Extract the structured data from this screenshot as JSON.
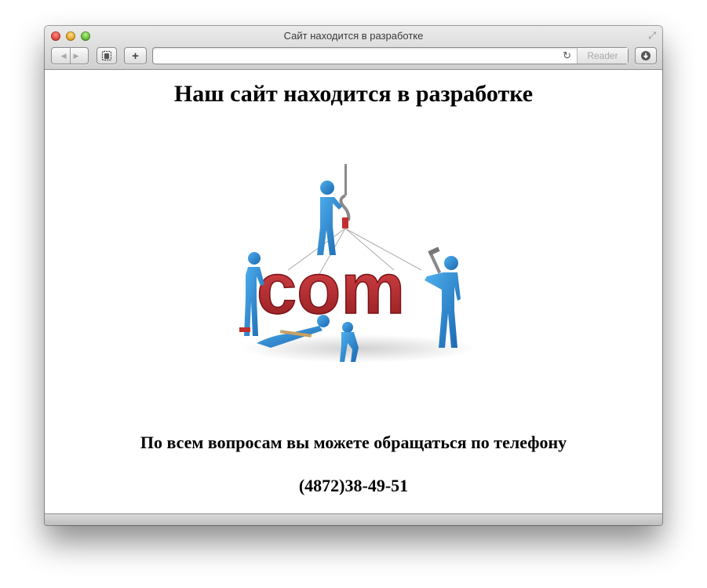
{
  "window": {
    "title": "Сайт находится в разработке"
  },
  "toolbar": {
    "back_icon": "◀",
    "forward_icon": "▶",
    "new_tab_label": "+",
    "reader_label": "Reader",
    "reload_icon": "↻"
  },
  "content": {
    "headline": "Наш сайт находится в разработке",
    "illustration_text": "com",
    "contact_text": "По всем вопросам вы можете обращаться по телефону",
    "phone": "(4872)38-49-51"
  },
  "colors": {
    "figure_blue": "#2a86d1",
    "letters_red": "#b8282c"
  }
}
